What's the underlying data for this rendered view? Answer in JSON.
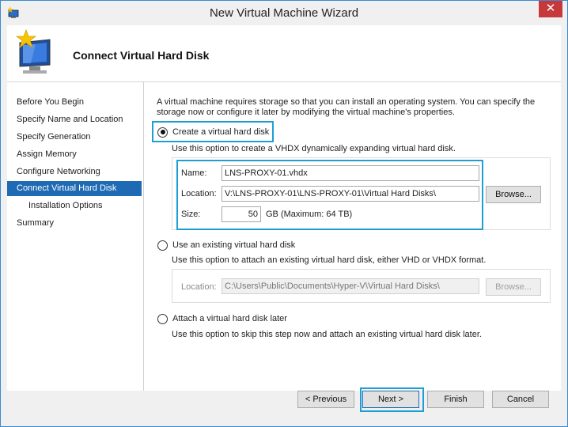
{
  "window": {
    "title": "New Virtual Machine Wizard",
    "close_glyph": "✕"
  },
  "header": {
    "title": "Connect Virtual Hard Disk",
    "icon": "wizard-computer-icon"
  },
  "nav": {
    "items": [
      {
        "label": "Before You Begin"
      },
      {
        "label": "Specify Name and Location"
      },
      {
        "label": "Specify Generation"
      },
      {
        "label": "Assign Memory"
      },
      {
        "label": "Configure Networking"
      },
      {
        "label": "Connect Virtual Hard Disk"
      },
      {
        "label": "Installation Options"
      },
      {
        "label": "Summary"
      }
    ]
  },
  "content": {
    "description": "A virtual machine requires storage so that you can install an operating system. You can specify the storage now or configure it later by modifying the virtual machine's properties.",
    "create": {
      "label": "Create a virtual hard disk",
      "description": "Use this option to create a VHDX dynamically expanding virtual hard disk.",
      "name_label": "Name:",
      "name_value": "LNS-PROXY-01.vhdx",
      "location_label": "Location:",
      "location_value": "V:\\LNS-PROXY-01\\LNS-PROXY-01\\Virtual Hard Disks\\",
      "browse_label": "Browse...",
      "size_label": "Size:",
      "size_value": "50",
      "size_unit": "GB (Maximum: 64 TB)"
    },
    "existing": {
      "label": "Use an existing virtual hard disk",
      "description": "Use this option to attach an existing virtual hard disk, either VHD or VHDX format.",
      "location_label": "Location:",
      "location_value": "C:\\Users\\Public\\Documents\\Hyper-V\\Virtual Hard Disks\\",
      "browse_label": "Browse..."
    },
    "later": {
      "label": "Attach a virtual hard disk later",
      "description": "Use this option to skip this step now and attach an existing virtual hard disk later."
    }
  },
  "footer": {
    "previous": "< Previous",
    "next": "Next >",
    "finish": "Finish",
    "cancel": "Cancel"
  },
  "colors": {
    "accent": "#1e6ab5",
    "highlight": "#1e9fd4",
    "close": "#c7383a"
  }
}
